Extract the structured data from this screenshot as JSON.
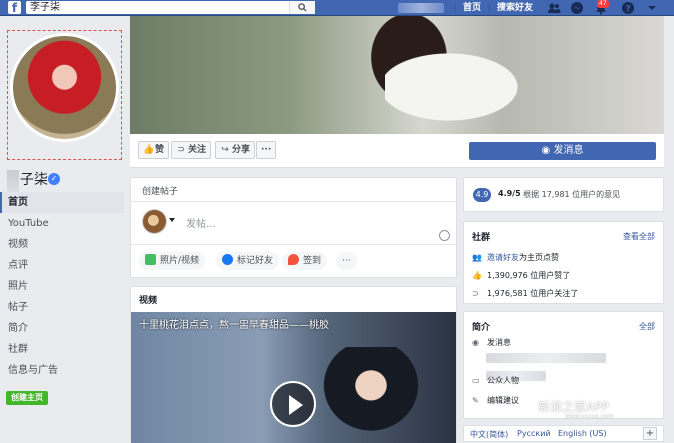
{
  "topbar": {
    "search_value": "李子柒",
    "nav_home": "首页",
    "nav_find_friends": "搜索好友",
    "notification_count": "47"
  },
  "sidebar": {
    "page_name": "子柒",
    "items": [
      {
        "label": "首页",
        "active": true
      },
      {
        "label": "YouTube"
      },
      {
        "label": "视频"
      },
      {
        "label": "点评"
      },
      {
        "label": "照片"
      },
      {
        "label": "帖子"
      },
      {
        "label": "简介"
      },
      {
        "label": "社群"
      },
      {
        "label": "信息与广告"
      }
    ],
    "create_page_label": "创建主页"
  },
  "actions": {
    "like": "赞",
    "follow": "关注",
    "share": "分享",
    "more": "···",
    "message": "发消息"
  },
  "composer": {
    "title": "创建帖子",
    "placeholder": "发帖…",
    "photo_video": "照片/视频",
    "tag_friends": "标记好友",
    "checkin": "签到",
    "more": "···"
  },
  "video": {
    "section_title": "视频",
    "title": "十里桃花泪点点，熬一盅早春甜品——桃胶"
  },
  "rating": {
    "pill": "4.9",
    "score": "4.9/5",
    "text": "· 根据 17,981 位用户的意见"
  },
  "community": {
    "title": "社群",
    "see_all": "查看全部",
    "invite_link": "邀请好友",
    "invite_rest": "为主页点赞",
    "likes": "1,390,976 位用户赞了",
    "follows": "1,976,581 位用户关注了"
  },
  "intro": {
    "title": "简介",
    "see_all": "全部",
    "send_message": "发消息",
    "category": "公众人物",
    "suggest_edit": "编辑建议"
  },
  "footer": {
    "languages": [
      "中文(简体)",
      "English (US)",
      "Русский"
    ]
  },
  "watermark": {
    "text": "新浪之家APP",
    "sub": "www.xxxxx.com"
  },
  "colors": {
    "brand": "#4267b2",
    "link": "#365899",
    "create_green": "#42b72a"
  }
}
